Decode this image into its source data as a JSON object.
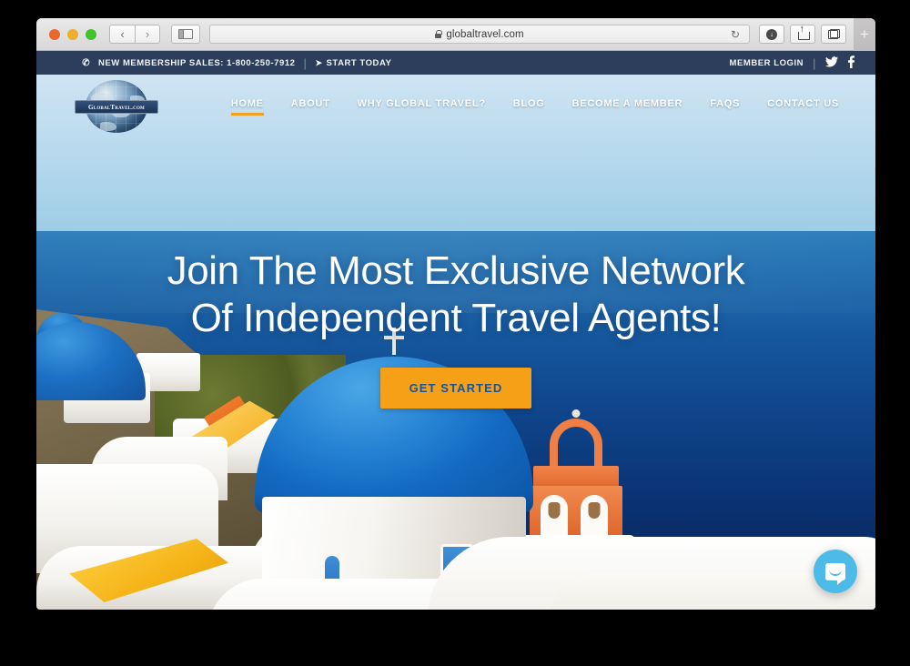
{
  "browser": {
    "url": "globaltravel.com",
    "lock_icon": "lock-icon",
    "reload_icon": "↻",
    "back_icon": "‹",
    "forward_icon": "›",
    "sidebar_icon": "sidebar-icon",
    "download_icon": "↓",
    "share_icon": "share-icon",
    "tabs_icon": "tabs-icon",
    "new_tab_label": "+"
  },
  "top_bar": {
    "phone_icon": "✆",
    "sales_text": "NEW MEMBERSHIP SALES: 1-800-250-7912",
    "divider": "|",
    "arrow_icon": "➤",
    "start_today": "START TODAY",
    "member_login": "MEMBER LOGIN",
    "twitter_icon": "🐦",
    "facebook_icon": "f"
  },
  "header": {
    "logo_text": "GlobalTravel.com",
    "nav": [
      {
        "label": "HOME",
        "active": true
      },
      {
        "label": "ABOUT",
        "active": false
      },
      {
        "label": "WHY GLOBAL TRAVEL?",
        "active": false
      },
      {
        "label": "BLOG",
        "active": false
      },
      {
        "label": "BECOME A MEMBER",
        "active": false
      },
      {
        "label": "FAQS",
        "active": false
      },
      {
        "label": "CONTACT US",
        "active": false
      }
    ]
  },
  "hero": {
    "title_line1": "Join The Most Exclusive Network",
    "title_line2": "Of Independent Travel Agents!",
    "cta_label": "GET STARTED",
    "image_description": "Santorini blue-domed church overlooking the Aegean sea"
  },
  "chat": {
    "icon": "chat-bubble-icon"
  },
  "colors": {
    "top_bar_bg": "#2c3e5b",
    "cta_bg": "#f5a017",
    "cta_text": "#17539a",
    "nav_active_underline": "#f0a01e",
    "chat_bg": "#4cbbe8"
  }
}
